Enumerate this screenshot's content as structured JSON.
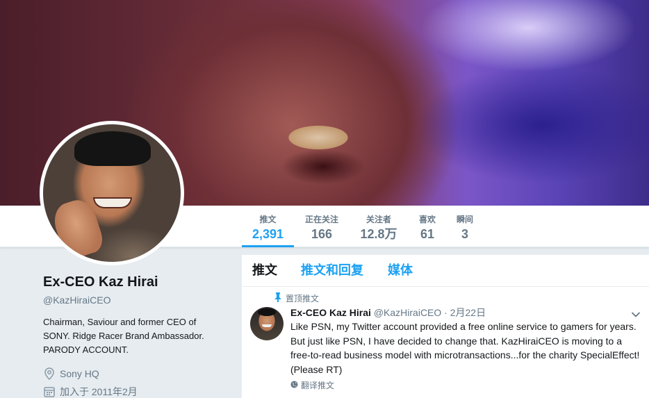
{
  "stats": [
    {
      "label": "推文",
      "value": "2,391",
      "active": true
    },
    {
      "label": "正在关注",
      "value": "166"
    },
    {
      "label": "关注者",
      "value": "12.8万"
    },
    {
      "label": "喜欢",
      "value": "61"
    },
    {
      "label": "瞬间",
      "value": "3"
    }
  ],
  "profile": {
    "name": "Ex-CEO Kaz Hirai",
    "handle": "@KazHiraiCEO",
    "bio": "Chairman, Saviour and former CEO of SONY. Ridge Racer Brand Ambassador. PARODY ACCOUNT.",
    "location": "Sony HQ",
    "joined": "加入于 2011年2月"
  },
  "tabs": [
    {
      "label": "推文",
      "active": true
    },
    {
      "label": "推文和回复"
    },
    {
      "label": "媒体"
    }
  ],
  "tweet": {
    "pinned_label": "置顶推文",
    "name": "Ex-CEO Kaz Hirai",
    "handle": "@KazHiraiCEO",
    "separator": "·",
    "date": "2月22日",
    "text": "Like PSN, my Twitter account provided a free online service to gamers for years. But just like PSN, I have decided to change that. KazHiraiCEO is moving to a free-to-read business model with microtransactions...for the charity SpecialEffect! (Please RT)",
    "translate_label": "翻译推文"
  },
  "icons": {
    "pin": "pin-icon",
    "location": "location-pin-icon",
    "calendar": "calendar-icon",
    "chevron": "chevron-down-icon",
    "globe": "globe-icon"
  },
  "colors": {
    "accent": "#1da1f2",
    "muted": "#657786",
    "text": "#14171a",
    "bg": "#e6ecf0"
  }
}
